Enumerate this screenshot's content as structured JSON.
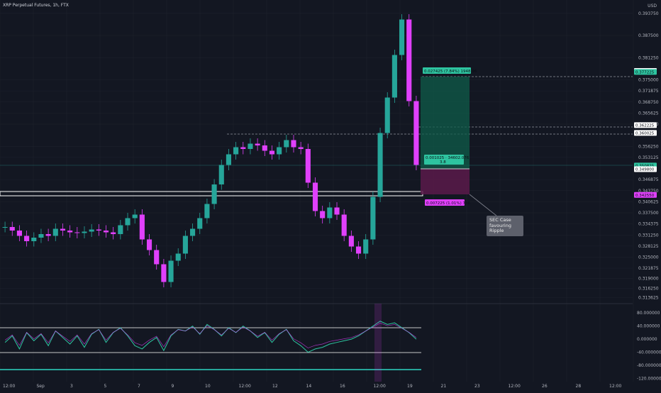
{
  "header": {
    "symbol_line": "XRP Perpetual Futures, 1h, FTX",
    "currency": "USD"
  },
  "colors": {
    "up": "#26a69a",
    "down": "#e040fb",
    "bg": "#131722",
    "grid": "#1e222d",
    "target": "#0f5c49",
    "stop": "#5b1a4a",
    "accent": "#2ec4a0"
  },
  "chart_data": [
    {
      "type": "candlestick",
      "title": "XRP Perpetual Futures, 1h, FTX",
      "y_axis_ticks": [
        "0.393750",
        "0.387500",
        "0.381250",
        "0.375000",
        "0.371875",
        "0.368750",
        "0.365625",
        "0.362500",
        "0.356250",
        "0.353125",
        "0.346875",
        "0.343750",
        "0.340625",
        "0.337500",
        "0.334375",
        "0.331250",
        "0.328125",
        "0.325000",
        "0.321875",
        "0.319000",
        "0.316250",
        "0.313625"
      ],
      "x_axis_ticks": [
        "12:00",
        "Sep",
        "3",
        "5",
        "7",
        "9",
        "10",
        "12:00",
        "12",
        "14",
        "16",
        "12:00",
        "19",
        "21",
        "23",
        "12:00",
        "26",
        "28",
        "12:00"
      ],
      "ylim": [
        0.3125,
        0.3975
      ],
      "price_tags": [
        "0.377500",
        "0.377225",
        "0.362225",
        "0.360025",
        "0.350825",
        "0.349800",
        "0.342550"
      ],
      "series": [
        {
          "x": [
            0,
            1,
            2,
            3,
            4,
            5,
            6,
            7,
            8,
            9,
            10,
            11,
            12,
            13,
            14,
            15,
            16,
            17,
            18,
            19,
            20,
            21,
            22,
            23,
            24,
            25,
            26,
            27,
            28,
            29,
            30,
            31,
            32,
            33,
            34,
            35,
            36,
            37,
            38,
            39,
            40,
            41,
            42,
            43,
            44,
            45,
            46,
            47,
            48,
            49,
            50,
            51,
            52,
            53,
            54,
            55,
            56,
            57
          ],
          "close": [
            0.3335,
            0.3325,
            0.331,
            0.3295,
            0.3305,
            0.3315,
            0.331,
            0.333,
            0.3325,
            0.332,
            0.3318,
            0.3322,
            0.3328,
            0.3325,
            0.332,
            0.3315,
            0.334,
            0.336,
            0.337,
            0.33,
            0.327,
            0.323,
            0.318,
            0.324,
            0.326,
            0.331,
            0.333,
            0.336,
            0.34,
            0.3455,
            0.351,
            0.354,
            0.356,
            0.3555,
            0.357,
            0.3565,
            0.355,
            0.354,
            0.356,
            0.358,
            0.356,
            0.3555,
            0.346,
            0.338,
            0.336,
            0.339,
            0.337,
            0.331,
            0.328,
            0.326,
            0.33,
            0.342,
            0.36,
            0.37,
            0.382,
            0.392,
            0.369,
            0.351
          ]
        }
      ]
    },
    {
      "type": "line",
      "title": "",
      "y_axis_ticks": [
        "80.000000",
        "40.000000",
        "0.000000",
        "-40.000000",
        "-80.000000",
        "-120.000000"
      ],
      "ylim": [
        -130,
        100
      ],
      "series": [
        {
          "x": [
            0,
            1,
            2,
            3,
            4,
            5,
            6,
            7,
            8,
            9,
            10,
            11,
            12,
            13,
            14,
            15,
            16,
            17,
            18,
            19,
            20,
            21,
            22,
            23,
            24,
            25,
            26,
            27,
            28,
            29,
            30,
            31,
            32,
            33,
            34,
            35,
            36,
            37,
            38,
            39,
            40,
            41,
            42,
            43,
            44,
            45,
            46,
            47,
            48,
            49,
            50,
            51,
            52,
            53,
            54,
            55,
            56,
            57
          ],
          "values": [
            -10,
            10,
            -30,
            20,
            -5,
            15,
            -20,
            25,
            5,
            -15,
            10,
            -25,
            15,
            30,
            -10,
            20,
            35,
            10,
            -20,
            -30,
            -10,
            5,
            -35,
            10,
            30,
            25,
            40,
            15,
            45,
            30,
            10,
            35,
            20,
            40,
            25,
            5,
            20,
            -10,
            15,
            30,
            -5,
            -20,
            -40,
            -30,
            -25,
            -15,
            -10,
            -5,
            0,
            10,
            25,
            40,
            55,
            45,
            50,
            35,
            20,
            0
          ]
        }
      ]
    }
  ],
  "position": {
    "target_label": "0.027425 (7.84%) 1948.96",
    "entry_label_line1": "0.001025 · 34602.076",
    "entry_label_line2": "3.8",
    "stop_label": "0.007225 (1.01%) 736"
  },
  "note": {
    "line1": "SEC Case",
    "line2": "favouring",
    "line3": "Ripple"
  }
}
